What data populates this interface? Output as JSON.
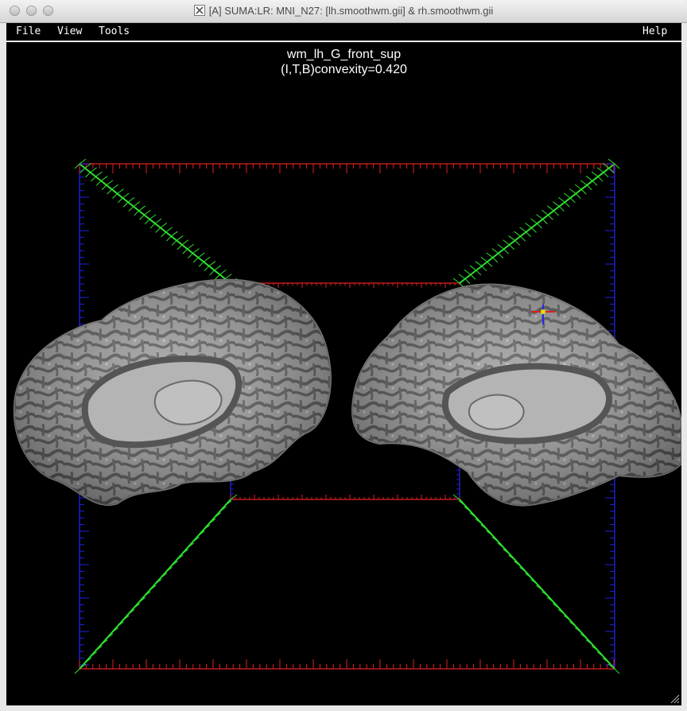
{
  "window": {
    "title": "[A] SUMA:LR: MNI_N27: [lh.smoothwm.gii] & rh.smoothwm.gii",
    "app_icon": "x11-icon"
  },
  "menu": {
    "file": "File",
    "view": "View",
    "tools": "Tools",
    "help": "Help"
  },
  "viewer": {
    "region_label": "wm_lh_G_front_sup",
    "value_label": "(I,T,B)convexity=0.420",
    "background": "#000000"
  },
  "colors": {
    "axis_x": "#e02020",
    "axis_y": "#2020e0",
    "axis_z": "#30e030",
    "cortex_light": "#a8a8a8",
    "cortex_dark": "#5c5c5c",
    "crosshair_node": "#e0e000"
  }
}
